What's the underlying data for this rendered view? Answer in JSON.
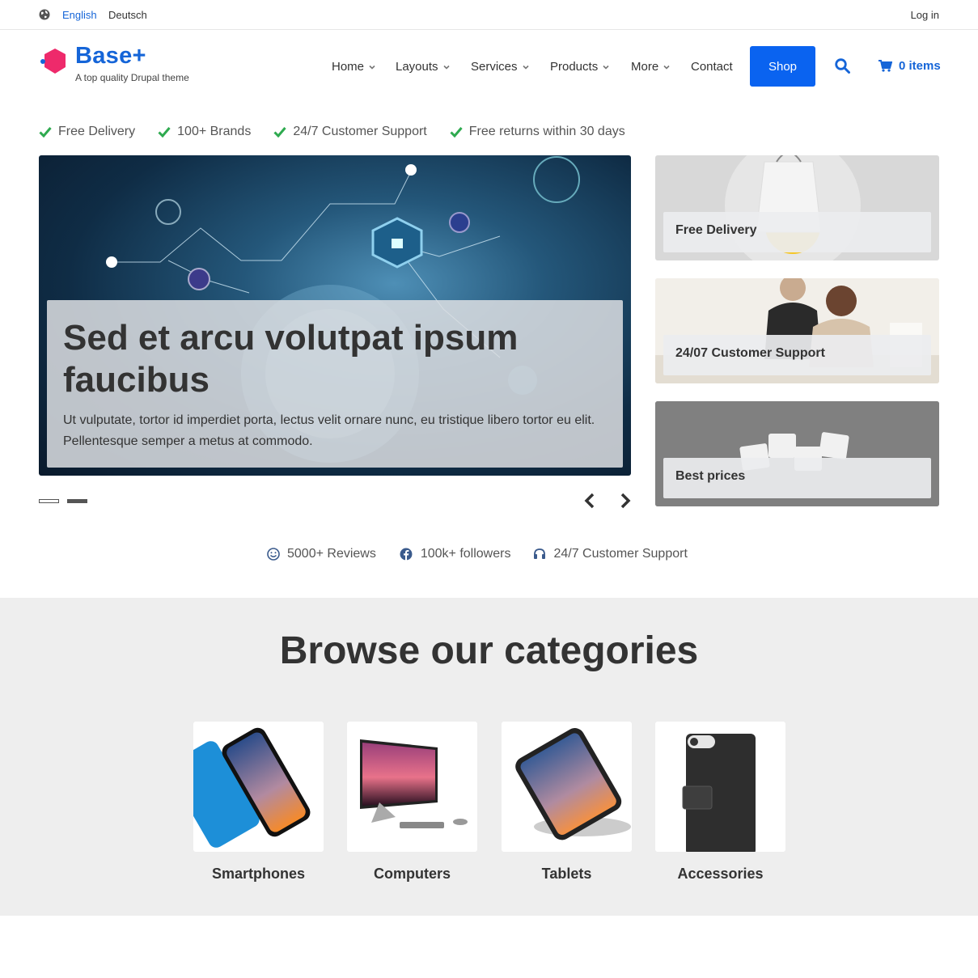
{
  "topbar": {
    "languages": [
      "English",
      "Deutsch"
    ],
    "active_language": "English",
    "login": "Log in",
    "icon": "globe-icon"
  },
  "header": {
    "site_name": "Base+",
    "slogan": "A top quality Drupal theme",
    "nav": [
      "Home",
      "Layouts",
      "Services",
      "Products",
      "More",
      "Contact"
    ],
    "shop": "Shop",
    "cart": "0 items",
    "accent": "#1565d8",
    "shop_bg": "#0a63f0"
  },
  "features": [
    "Free Delivery",
    "100+ Brands",
    "24/7 Customer Support",
    "Free returns within 30 days"
  ],
  "hero": {
    "title": "Sed et arcu volutpat ipsum faucibus",
    "text": "Ut vulputate, tortor id imperdiet porta, lectus velit ornare nunc, eu tristique libero tortor eu elit. Pellentesque semper a metus at commodo."
  },
  "side_cards": [
    "Free Delivery",
    "24/07 Customer Support",
    "Best prices"
  ],
  "social": [
    "5000+ Reviews",
    "100k+ followers",
    "24/7 Customer Support"
  ],
  "categories": {
    "title": "Browse our categories",
    "items": [
      "Smartphones",
      "Computers",
      "Tablets",
      "Accessories"
    ]
  },
  "colors": {
    "check": "#2eaa4f",
    "social_icon": "#3a5a8c"
  }
}
